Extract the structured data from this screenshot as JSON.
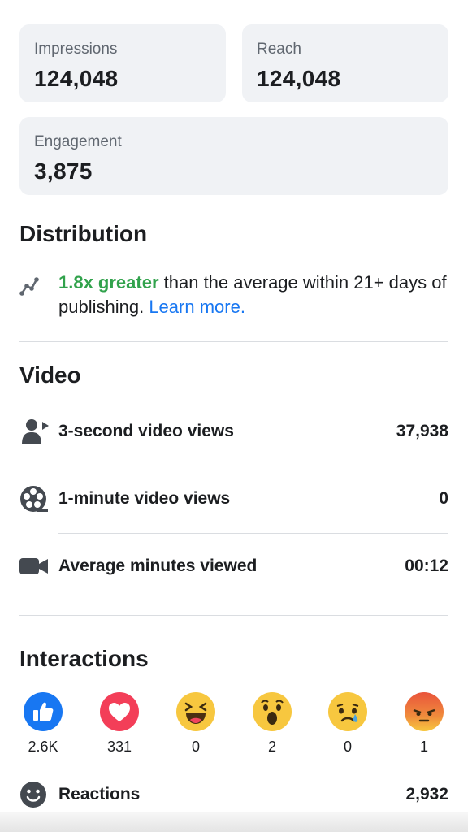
{
  "summary": {
    "impressions": {
      "label": "Impressions",
      "value": "124,048"
    },
    "reach": {
      "label": "Reach",
      "value": "124,048"
    },
    "engagement": {
      "label": "Engagement",
      "value": "3,875"
    }
  },
  "distribution": {
    "title": "Distribution",
    "highlight": "1.8x greater",
    "text": " than the average within 21+ days of publishing. ",
    "link": "Learn more.",
    "highlight_color": "#31a24c",
    "link_color": "#1877f2"
  },
  "video": {
    "title": "Video",
    "rows": [
      {
        "label": "3-second video views",
        "value": "37,938",
        "icon": "viewers-icon"
      },
      {
        "label": "1-minute video views",
        "value": "0",
        "icon": "film-reel-icon"
      },
      {
        "label": "Average minutes viewed",
        "value": "00:12",
        "icon": "video-camera-icon"
      }
    ]
  },
  "interactions": {
    "title": "Interactions",
    "reactions": [
      {
        "icon": "like-icon",
        "count": "2.6K"
      },
      {
        "icon": "love-icon",
        "count": "331"
      },
      {
        "icon": "haha-icon",
        "count": "0"
      },
      {
        "icon": "wow-icon",
        "count": "2"
      },
      {
        "icon": "sad-icon",
        "count": "0"
      },
      {
        "icon": "angry-icon",
        "count": "1"
      }
    ],
    "reactions_row": {
      "label": "Reactions",
      "value": "2,932",
      "icon": "smiley-icon"
    }
  }
}
